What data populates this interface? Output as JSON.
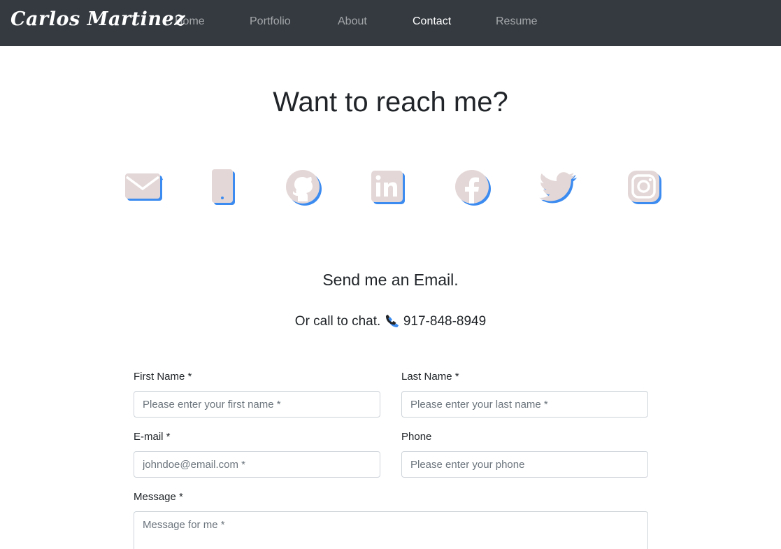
{
  "brand": "Carlos Martinez",
  "nav": {
    "items": [
      {
        "label": "Home"
      },
      {
        "label": "Portfolio"
      },
      {
        "label": "About"
      },
      {
        "label": "Contact"
      },
      {
        "label": "Resume"
      }
    ],
    "active": "Contact"
  },
  "heading": "Want to reach me?",
  "social_icons": [
    "email-icon",
    "mobile-phone-icon",
    "github-icon",
    "linkedin-icon",
    "facebook-icon",
    "twitter-icon",
    "instagram-icon"
  ],
  "colors": {
    "navbar_bg": "#343a40",
    "icon_fill": "#e4d7d7",
    "icon_shadow": "#3b8bf0",
    "text": "#212529"
  },
  "email_prompt": "Send me an Email.",
  "call_prompt": "Or call to chat.",
  "phone_number": "917-848-8949",
  "form": {
    "first_name": {
      "label": "First Name *",
      "placeholder": "Please enter your first name *"
    },
    "last_name": {
      "label": "Last Name *",
      "placeholder": "Please enter your last name *"
    },
    "email": {
      "label": "E-mail *",
      "placeholder": "johndoe@email.com *"
    },
    "phone": {
      "label": "Phone",
      "placeholder": "Please enter your phone"
    },
    "message": {
      "label": "Message *",
      "placeholder": "Message for me *"
    }
  }
}
